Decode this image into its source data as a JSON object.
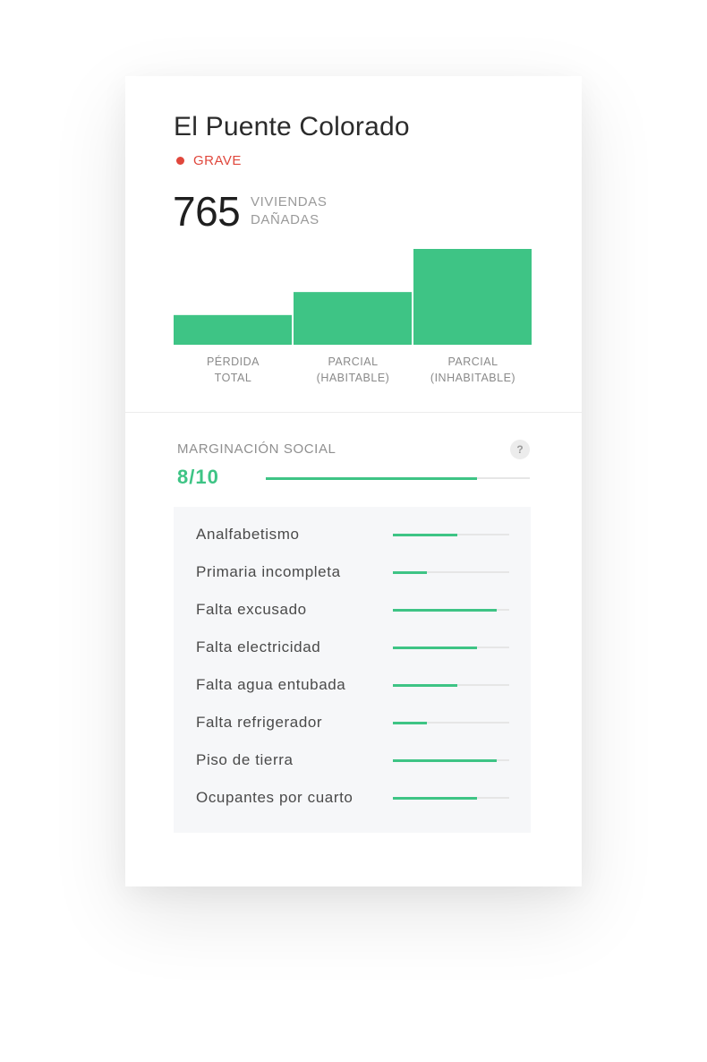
{
  "card": {
    "title": "El Puente Colorado",
    "severity": {
      "label": "GRAVE",
      "color": "#e0473c"
    },
    "damaged": {
      "number": "765",
      "unit": "VIVIENDAS DAÑADAS"
    }
  },
  "chart_data": {
    "type": "bar",
    "categories": [
      "PÉRDIDA TOTAL",
      "PARCIAL (HABITABLE)",
      "PARCIAL (INHABITABLE)"
    ],
    "values": [
      31,
      55,
      100
    ],
    "ylim": [
      0,
      100
    ],
    "color": "#3ec485",
    "grid": false,
    "legend": "none"
  },
  "marginacion": {
    "title": "MARGINACIÓN SOCIAL",
    "help": "?",
    "score": "8/10",
    "fraction": 0.8,
    "accent": "#3ec485",
    "indicators": [
      {
        "label": "Analfabetismo",
        "fraction": 0.55
      },
      {
        "label": "Primaria incompleta",
        "fraction": 0.29
      },
      {
        "label": "Falta excusado",
        "fraction": 0.89
      },
      {
        "label": "Falta electricidad",
        "fraction": 0.72
      },
      {
        "label": "Falta agua entubada",
        "fraction": 0.55
      },
      {
        "label": "Falta refrigerador",
        "fraction": 0.29
      },
      {
        "label": "Piso de tierra",
        "fraction": 0.89
      },
      {
        "label": "Ocupantes por cuarto",
        "fraction": 0.72
      }
    ]
  }
}
